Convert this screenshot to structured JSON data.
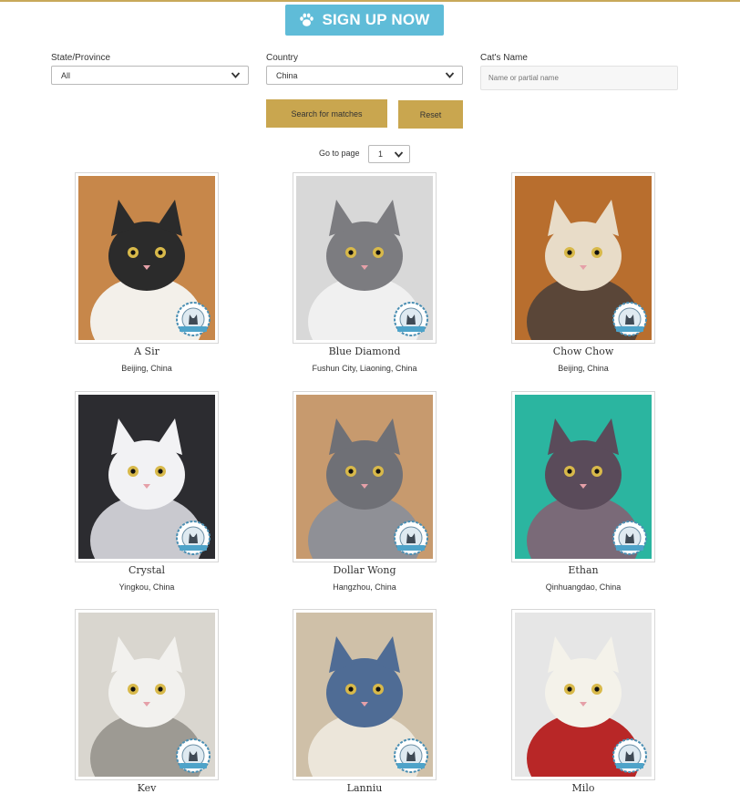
{
  "signup": {
    "label": "SIGN UP NOW",
    "icon": "paw-icon"
  },
  "filters": {
    "state_label": "State/Province",
    "state_value": "All",
    "country_label": "Country",
    "country_value": "China",
    "name_label": "Cat's Name",
    "name_placeholder": "Name or partial name"
  },
  "buttons": {
    "search": "Search for matches",
    "reset": "Reset"
  },
  "pagination": {
    "label": "Go to page",
    "page": "1"
  },
  "colors": {
    "accent_gold": "#c9a64f",
    "signup_blue": "#5fbcd8",
    "top_rule": "#c8a95a"
  },
  "cats": [
    {
      "name": "A Sir",
      "location": "Beijing, China"
    },
    {
      "name": "Blue Diamond",
      "location": "Fushun City, Liaoning, China"
    },
    {
      "name": "Chow Chow",
      "location": "Beijing, China"
    },
    {
      "name": "Crystal",
      "location": "Yingkou, China"
    },
    {
      "name": "Dollar Wong",
      "location": "Hangzhou, China"
    },
    {
      "name": "Ethan",
      "location": "Qinhuangdao, China"
    },
    {
      "name": "Kev",
      "location": ""
    },
    {
      "name": "Lanniu",
      "location": ""
    },
    {
      "name": "Milo",
      "location": ""
    }
  ]
}
